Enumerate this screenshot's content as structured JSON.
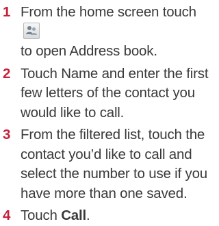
{
  "steps": [
    {
      "number": "1",
      "text_before_icon": "From the home screen touch",
      "icon": "contacts-icon",
      "text_after_icon": "to open Address book."
    },
    {
      "number": "2",
      "text": "Touch Name and enter the first few letters of the contact you would like to call."
    },
    {
      "number": "3",
      "text": "From the filtered list, touch the contact you’d like to call and select the number to use if you have more than one saved."
    },
    {
      "number": "4",
      "text_prefix": "Touch ",
      "bold": "Call",
      "text_suffix": "."
    }
  ],
  "colors": {
    "step_number": "#c8203a",
    "body_text": "#3a3a3a"
  }
}
